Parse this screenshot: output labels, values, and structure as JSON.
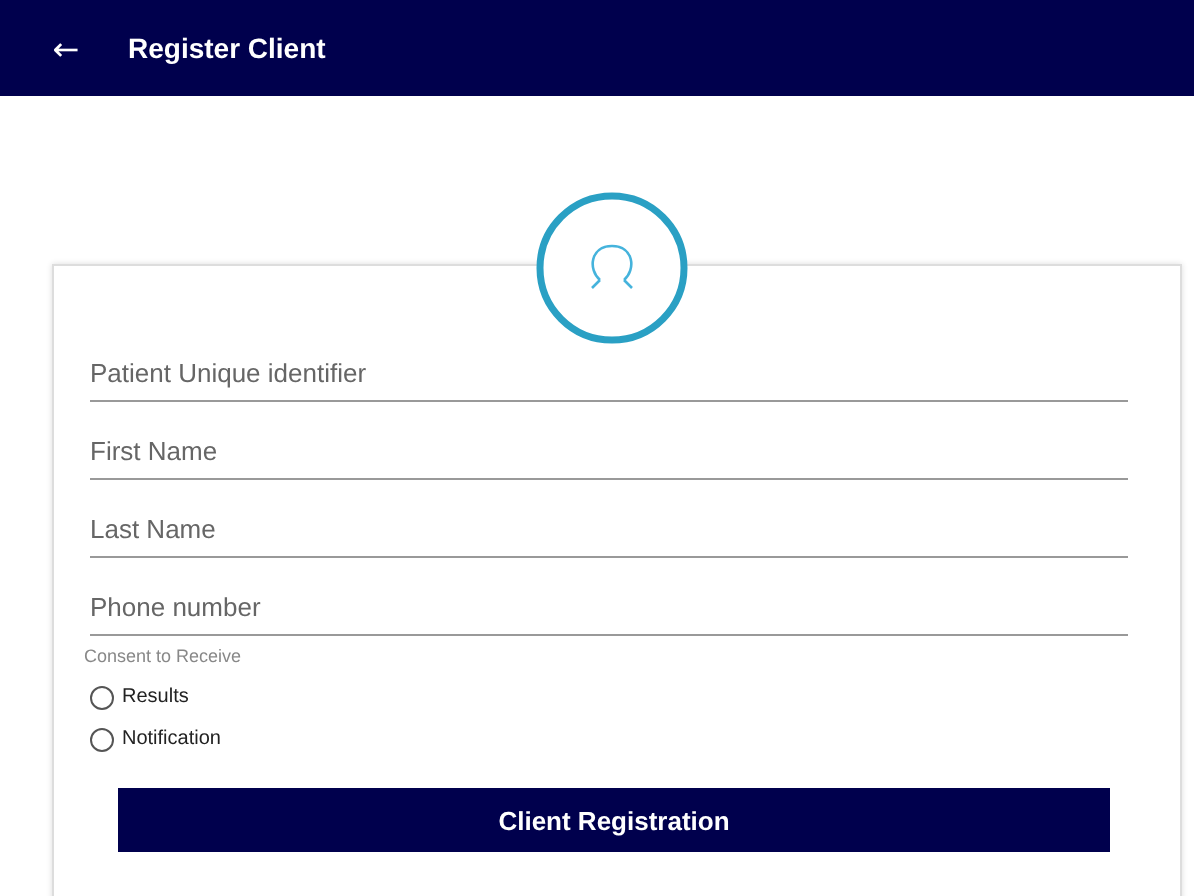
{
  "app_bar": {
    "back_icon": "←",
    "title": "Register Client"
  },
  "form": {
    "fields": [
      {
        "placeholder": "Patient Unique identifier"
      },
      {
        "placeholder": "First Name"
      },
      {
        "placeholder": "Last Name"
      },
      {
        "placeholder": "Phone number"
      }
    ],
    "consent": {
      "label": "Consent to Receive",
      "options": [
        {
          "label": "Results",
          "selected": false
        },
        {
          "label": "Notification",
          "selected": false
        }
      ]
    },
    "submit_button": "Client Registration"
  }
}
